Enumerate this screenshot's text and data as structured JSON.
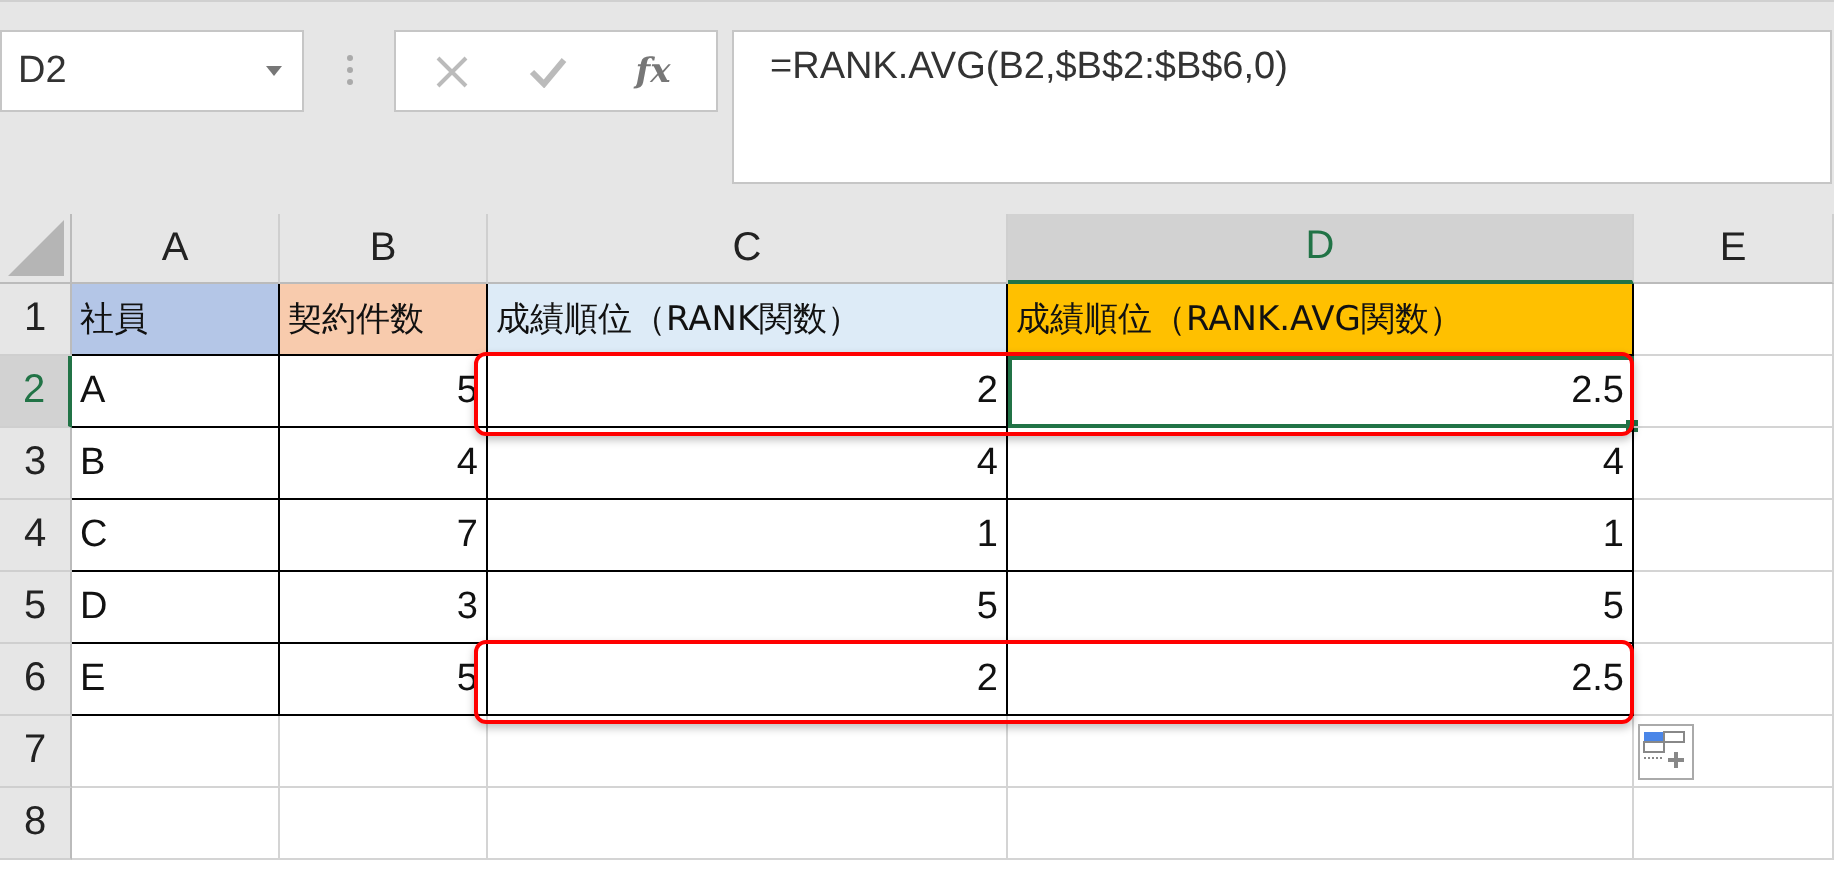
{
  "name_box": {
    "value": "D2"
  },
  "formula_bar": {
    "function_button": "fx",
    "formula": "=RANK.AVG(B2,$B$2:$B$6,0)"
  },
  "columns": [
    {
      "label": "A",
      "selected": false
    },
    {
      "label": "B",
      "selected": false
    },
    {
      "label": "C",
      "selected": false
    },
    {
      "label": "D",
      "selected": true
    },
    {
      "label": "E",
      "selected": false
    }
  ],
  "header_row": {
    "number": "1",
    "selected": false,
    "cells": [
      {
        "text": "社員",
        "color": "#b4c6e7"
      },
      {
        "text": "契約件数",
        "color": "#f8cbad"
      },
      {
        "text": "成績順位（RANK関数）",
        "color": "#ddebf7"
      },
      {
        "text": "成績順位（RANK.AVG関数）",
        "color": "#ffc000"
      }
    ]
  },
  "rows": [
    {
      "number": "2",
      "selected": true,
      "highlighted": true,
      "cells": [
        "A",
        "5",
        "2",
        "2.5"
      ]
    },
    {
      "number": "3",
      "selected": false,
      "highlighted": false,
      "cells": [
        "B",
        "4",
        "4",
        "4"
      ]
    },
    {
      "number": "4",
      "selected": false,
      "highlighted": false,
      "cells": [
        "C",
        "7",
        "1",
        "1"
      ]
    },
    {
      "number": "5",
      "selected": false,
      "highlighted": false,
      "cells": [
        "D",
        "3",
        "5",
        "5"
      ]
    },
    {
      "number": "6",
      "selected": false,
      "highlighted": true,
      "cells": [
        "E",
        "5",
        "2",
        "2.5"
      ]
    },
    {
      "number": "7",
      "selected": false,
      "highlighted": false,
      "cells": []
    },
    {
      "number": "8",
      "selected": false,
      "highlighted": false,
      "cells": []
    }
  ],
  "paste_options": {
    "visible": true
  }
}
